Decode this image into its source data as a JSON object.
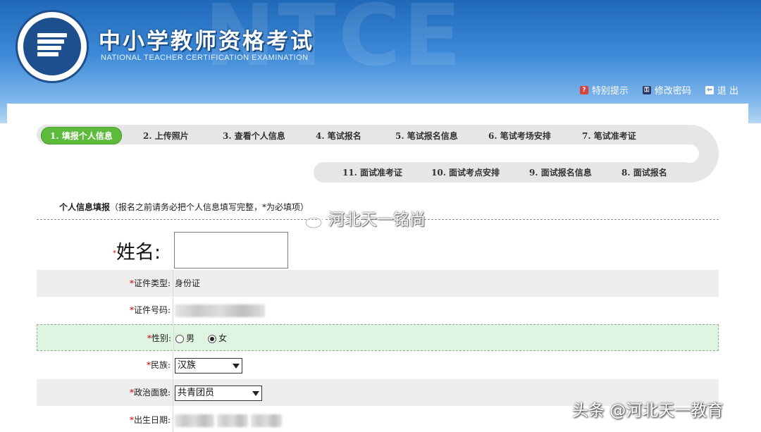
{
  "header": {
    "title": "中小学教师资格考试",
    "subtitle": "NATIONAL TEACHER CERTIFICATION EXAMINATION",
    "watermark_text": "NTCE",
    "links": [
      {
        "icon": "question-icon",
        "label": "特别提示"
      },
      {
        "icon": "key-icon",
        "label": "修改密码"
      },
      {
        "icon": "exit-icon",
        "label": "退 出"
      }
    ]
  },
  "steps": [
    {
      "label": "1. 填报个人信息",
      "active": true
    },
    {
      "label": "2. 上传照片"
    },
    {
      "label": "3. 查看个人信息"
    },
    {
      "label": "4. 笔试报名"
    },
    {
      "label": "5. 笔试报名信息"
    },
    {
      "label": "6. 笔试考场安排"
    },
    {
      "label": "7. 笔试准考证"
    },
    {
      "label": "8. 面试报名"
    },
    {
      "label": "9. 面试报名信息"
    },
    {
      "label": "10. 面试考点安排"
    },
    {
      "label": "11. 面试准考证"
    }
  ],
  "section": {
    "title": "个人信息填报",
    "note": "（报名之前请务必把个人信息填写完整，*为必填项）"
  },
  "form": {
    "name_label": "姓名:",
    "required_mark": "*",
    "id_type_label": "证件类型:",
    "id_type_value": "身份证",
    "id_number_label": "证件号码:",
    "gender_label": "性别:",
    "gender_male": "男",
    "gender_female": "女",
    "gender_selected": "女",
    "ethnicity_label": "民族:",
    "ethnicity_value": "汉族",
    "politics_label": "政治面貌:",
    "politics_value": "共青团员",
    "birth_label": "出生日期:"
  },
  "watermarks": {
    "weibo": "河北天一铭尚",
    "toutiao": "头条 @河北天一教育"
  },
  "colors": {
    "header_blue": "#2a73c4",
    "active_step_green": "#5cbb3a",
    "required_red": "#cc0000",
    "highlight_row_green": "#dff5e2"
  }
}
